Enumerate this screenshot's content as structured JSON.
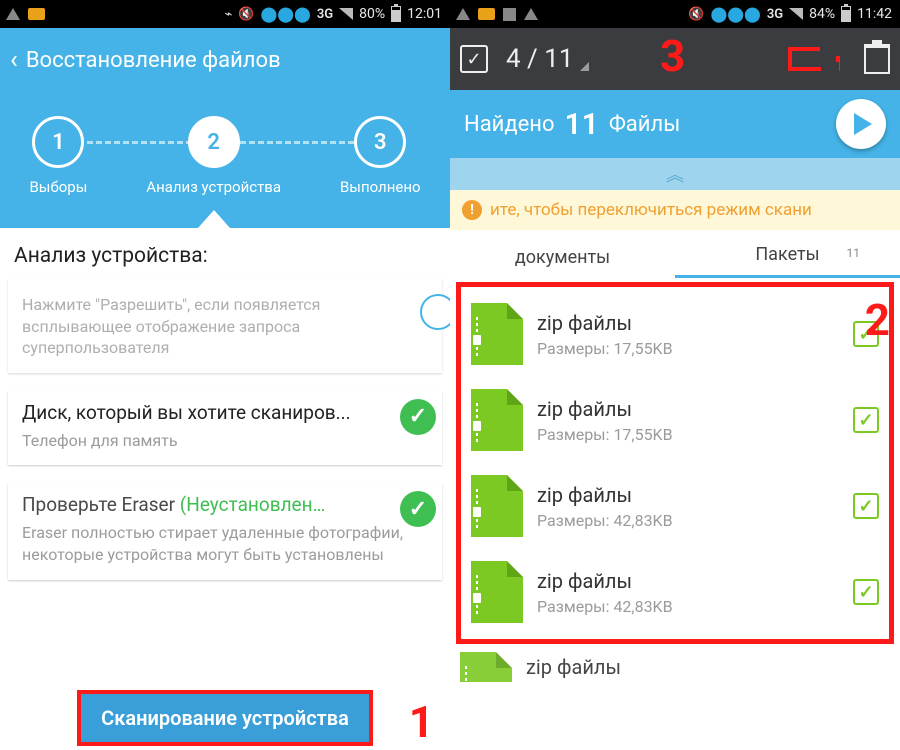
{
  "annotations": {
    "b1": "1",
    "b2": "2",
    "b3": "3"
  },
  "left": {
    "status": {
      "network": "3G",
      "battery_pct": "80%",
      "time": "12:01"
    },
    "title": "Восстановление файлов",
    "steps": [
      {
        "num": "1",
        "label": "Выборы"
      },
      {
        "num": "2",
        "label": "Анализ устройства"
      },
      {
        "num": "3",
        "label": "Выполнено"
      }
    ],
    "section_title": "Анализ устройства:",
    "cards": {
      "permission_hint": "Нажмите \"Разрешить\", если появляется всплывающее отображение запроса суперпользователя",
      "disk_title": "Диск, который вы хотите сканиров...",
      "disk_sub": "Телефон для память",
      "eraser_t1": "Проверьте Eraser ",
      "eraser_t2": "(Неустановлен…",
      "eraser_sub": "Eraser полностью стирает удаленные фотографии, некоторые устройства могут быть установлены"
    },
    "scan_button": "Сканирование устройства"
  },
  "right": {
    "status": {
      "network": "3G",
      "battery_pct": "84%",
      "time": "11:42"
    },
    "selection": "4 / 11",
    "found_label": "Найдено",
    "found_count": "11",
    "found_unit": "Файлы",
    "banner": "ите, чтобы переключиться режим скани",
    "tabs": {
      "docs": "документы",
      "pkgs": "Пакеты",
      "pkgs_count": "11"
    },
    "files": [
      {
        "name": "zip файлы",
        "size": "Размеры: 17,55KB"
      },
      {
        "name": "zip файлы",
        "size": "Размеры: 17,55KB"
      },
      {
        "name": "zip файлы",
        "size": "Размеры: 42,83KB"
      },
      {
        "name": "zip файлы",
        "size": "Размеры: 42,83KB"
      }
    ],
    "extra_file": {
      "name": "zip файлы"
    }
  }
}
